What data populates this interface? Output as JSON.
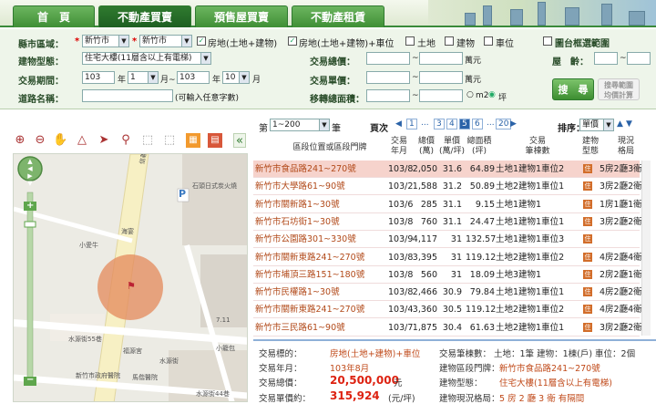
{
  "nav": {
    "tabs": [
      "首　頁",
      "不動產買賣",
      "預售屋買賣",
      "不動產租賃"
    ],
    "active_index": 1
  },
  "form": {
    "region_label": "縣市區域：",
    "county_value": "新竹市",
    "district_value": "新竹市",
    "checkbox_labels": [
      "房地(土地+建物)",
      "房地(土地+建物)+車位",
      "土地",
      "建物",
      "車位"
    ],
    "checkbox_checked": [
      true,
      true,
      false,
      false,
      false
    ],
    "map_box_label": "圖台框選範圍",
    "building_type_label": "建物型態：",
    "building_type_value": "住宅大樓(11層含以上有電梯)",
    "total_price_label": "交易總價：",
    "unit_wan": "萬元",
    "age_label": "屋　齡：",
    "period_label": "交易期間：",
    "year_from": "103",
    "year_unit": "年",
    "month_from": "1",
    "month_unit_to": "月~",
    "year_to": "103",
    "month_to": "10",
    "month_unit": "月",
    "unit_price_label": "交易單價：",
    "unit_price_unit": "萬元",
    "road_label": "道路名稱：",
    "road_hint": "(可輸入任意字數)",
    "area_label": "移轉總面積：",
    "area_unit_m2": "m2",
    "area_unit_ping": "坪",
    "search_button": "搜　尋",
    "search_range_button_line1": "搜尋範圍",
    "search_range_button_line2": "均價計算"
  },
  "map_tools": {
    "icons": [
      "zoom-in-icon",
      "zoom-out-icon",
      "pan-hand-icon",
      "measure-icon",
      "pin-icon",
      "location-icon",
      "select-icon",
      "clear-icon",
      "grid-icon",
      "table-icon"
    ],
    "collapse_glyph": "«"
  },
  "map": {
    "labels": [
      "石頭日式炭火燒",
      "海宴",
      "小愛牛",
      "水源街55巷",
      "福源宮",
      "新竹市政府醫院",
      "馬偕醫院",
      "水源街44巷",
      "7.11",
      "小籠包",
      "P",
      "信義街",
      "水源街"
    ]
  },
  "results": {
    "page_prefix": "第",
    "range_value": "1~200",
    "page_suffix": "筆",
    "page_label": "頁次",
    "pages": [
      "1",
      "...",
      "3",
      "4",
      "5",
      "6",
      "...",
      "20"
    ],
    "active_page": "5",
    "sort_label": "排序：",
    "sort_value": "單價",
    "columns": [
      [
        "區段位置或區段門牌"
      ],
      [
        "交易",
        "年月"
      ],
      [
        "總價",
        "(萬)"
      ],
      [
        "單價",
        "(萬/坪)"
      ],
      [
        "總面積",
        "(坪)"
      ],
      [
        "交易",
        "筆棟數"
      ],
      [
        "建物",
        "型態"
      ],
      [
        "現況",
        "格局"
      ]
    ],
    "rows": [
      {
        "addr": "新竹市食品路241~270號",
        "ym": "103/8",
        "total": "2,050",
        "unit": "31.6",
        "area": "64.89",
        "deals": "土地1建物1車位2",
        "type": "住",
        "layout": "5房2廳3衛",
        "highlight": true
      },
      {
        "addr": "新竹市大學路61~90號",
        "ym": "103/2",
        "total": "1,588",
        "unit": "31.2",
        "area": "50.89",
        "deals": "土地2建物1車位1",
        "type": "住",
        "layout": "3房2廳2衛",
        "highlight": false
      },
      {
        "addr": "新竹市關新路1~30號",
        "ym": "103/6",
        "total": "285",
        "unit": "31.1",
        "area": "9.15",
        "deals": "土地1建物1",
        "type": "住",
        "layout": "1房1廳1衛",
        "highlight": false
      },
      {
        "addr": "新竹市石坊街1~30號",
        "ym": "103/8",
        "total": "760",
        "unit": "31.1",
        "area": "24.47",
        "deals": "土地1建物1車位1",
        "type": "住",
        "layout": "3房2廳2衛",
        "highlight": false
      },
      {
        "addr": "新竹市公園路301~330號",
        "ym": "103/9",
        "total": "4,117",
        "unit": "31",
        "area": "132.57",
        "deals": "土地1建物1車位3",
        "type": "住",
        "layout": "",
        "highlight": false
      },
      {
        "addr": "新竹市關新東路241~270號",
        "ym": "103/8",
        "total": "3,395",
        "unit": "31",
        "area": "119.12",
        "deals": "土地2建物1車位2",
        "type": "住",
        "layout": "4房2廳4衛",
        "highlight": false
      },
      {
        "addr": "新竹市埔頂三路151~180號",
        "ym": "103/8",
        "total": "560",
        "unit": "31",
        "area": "18.09",
        "deals": "土地3建物1",
        "type": "住",
        "layout": "2房2廳1衛",
        "highlight": false
      },
      {
        "addr": "新竹市民權路1~30號",
        "ym": "103/8",
        "total": "2,466",
        "unit": "30.9",
        "area": "79.84",
        "deals": "土地1建物1車位1",
        "type": "住",
        "layout": "4房2廳2衛",
        "highlight": false
      },
      {
        "addr": "新竹市關新東路241~270號",
        "ym": "103/4",
        "total": "3,360",
        "unit": "30.5",
        "area": "119.12",
        "deals": "土地2建物1車位2",
        "type": "住",
        "layout": "4房2廳4衛",
        "highlight": false
      },
      {
        "addr": "新竹市三民路61~90號",
        "ym": "103/7",
        "total": "1,875",
        "unit": "30.4",
        "area": "61.63",
        "deals": "土地2建物1車位1",
        "type": "住",
        "layout": "3房2廳2衛",
        "highlight": false
      }
    ]
  },
  "detail": {
    "l1": "交易標的：",
    "v1": "房地(土地+建物)+車位",
    "l2": "交易筆棟數：",
    "v2": "土地：1筆 建物：1棟(戶) 車位：2個",
    "l3": "交易年月：",
    "v3": "103年8月",
    "l4": "建物區段門牌：",
    "v4": "新竹市食品路241~270號",
    "l5": "交易總價：",
    "v5": "20,500,000",
    "v5unit": "元",
    "l6": "建物型態：",
    "v6": "住宅大樓(11層含以上有電梯)",
    "l7": "交易單價約：",
    "v7": "315,924",
    "v7unit": "(元/坪)",
    "l8": "建物現況格局：",
    "v8": "5 房 2 廳 3 衛 有隔間"
  },
  "colors": {
    "accent": "#3f8f36",
    "highlight_row": "#f6d3cc",
    "address": "#b24a1a"
  }
}
